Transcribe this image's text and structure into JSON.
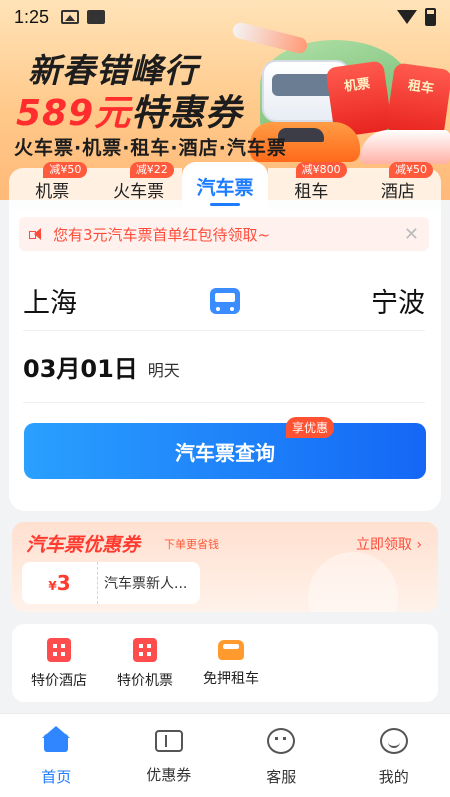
{
  "status_bar": {
    "time": "1:25"
  },
  "banner": {
    "title": "新春错峰行",
    "price": "589元",
    "ticket": "特惠券",
    "products": "火车票·机票·租车·酒店·汽车票",
    "envelope_labels": [
      "机票",
      "租车"
    ]
  },
  "tabs": [
    {
      "label": "机票",
      "badge": "减¥50",
      "active": false
    },
    {
      "label": "火车票",
      "badge": "减¥22",
      "active": false
    },
    {
      "label": "汽车票",
      "badge": "",
      "active": true
    },
    {
      "label": "租车",
      "badge": "减¥800",
      "active": false
    },
    {
      "label": "酒店",
      "badge": "减¥50",
      "active": false
    }
  ],
  "notice": {
    "text": "您有3元汽车票首单红包待领取~",
    "close": "✕"
  },
  "route": {
    "from": "上海",
    "to": "宁波"
  },
  "date": {
    "value": "03月01日",
    "tag": "明天"
  },
  "search": {
    "label": "汽车票查询",
    "badge": "享优惠"
  },
  "coupon": {
    "title": "汽车票优惠券",
    "slogan": "下单更省钱",
    "claim": "立即领取",
    "claim_arrow": "›",
    "item": {
      "currency": "¥",
      "amount": "3",
      "name": "汽车票新人..."
    }
  },
  "services": [
    {
      "label": "特价酒店",
      "icon": "hotel-icon"
    },
    {
      "label": "特价机票",
      "icon": "flight-icon"
    },
    {
      "label": "免押租车",
      "icon": "car-icon"
    }
  ],
  "bottom_nav": [
    {
      "label": "首页",
      "icon": "home-icon",
      "active": true
    },
    {
      "label": "优惠券",
      "icon": "coupon-icon",
      "active": false
    },
    {
      "label": "客服",
      "icon": "customer-service-icon",
      "active": false
    },
    {
      "label": "我的",
      "icon": "profile-icon",
      "active": false
    }
  ],
  "colors": {
    "accent": "#1e7cff",
    "promo_red": "#ff3b2f"
  }
}
